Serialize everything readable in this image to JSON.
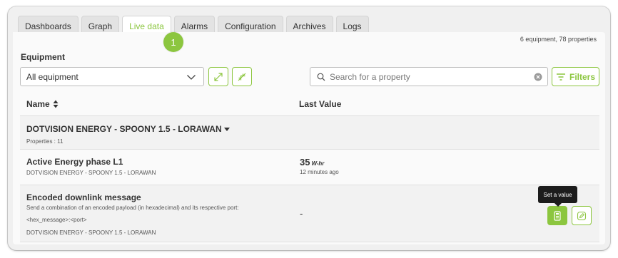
{
  "tabs": [
    {
      "label": "Dashboards",
      "active": false
    },
    {
      "label": "Graph",
      "active": false
    },
    {
      "label": "Live data",
      "active": true
    },
    {
      "label": "Alarms",
      "active": false
    },
    {
      "label": "Configuration",
      "active": false
    },
    {
      "label": "Archives",
      "active": false
    },
    {
      "label": "Logs",
      "active": false
    }
  ],
  "step_badge": "1",
  "summary": "6 equipment, 78 properties",
  "equipment": {
    "label": "Equipment",
    "selected": "All equipment"
  },
  "search": {
    "placeholder": "Search for a property",
    "value": ""
  },
  "filters_label": "Filters",
  "table": {
    "headers": {
      "name": "Name",
      "last_value": "Last Value"
    },
    "group": {
      "name": "DOTVISION ENERGY - SPOONY 1.5 - LORAWAN",
      "properties": "Properties : 11"
    },
    "rows": [
      {
        "name": "Active Energy phase L1",
        "equipment": "DOTVISION ENERGY - SPOONY 1.5 - LORAWAN",
        "value": "35",
        "unit": "W-hr",
        "updated": "12 minutes ago"
      },
      {
        "name": "Encoded downlink message",
        "description": "Send a combination of an encoded payload (in hexadecimal) and its respective port:",
        "description_2": "<hex_message>:<port>",
        "equipment": "DOTVISION ENERGY - SPOONY 1.5 - LORAWAN",
        "value": "-"
      }
    ]
  },
  "tooltip": "Set a value",
  "colors": {
    "accent": "#8cc63f",
    "tooltip_bg": "#1c1c1c"
  }
}
